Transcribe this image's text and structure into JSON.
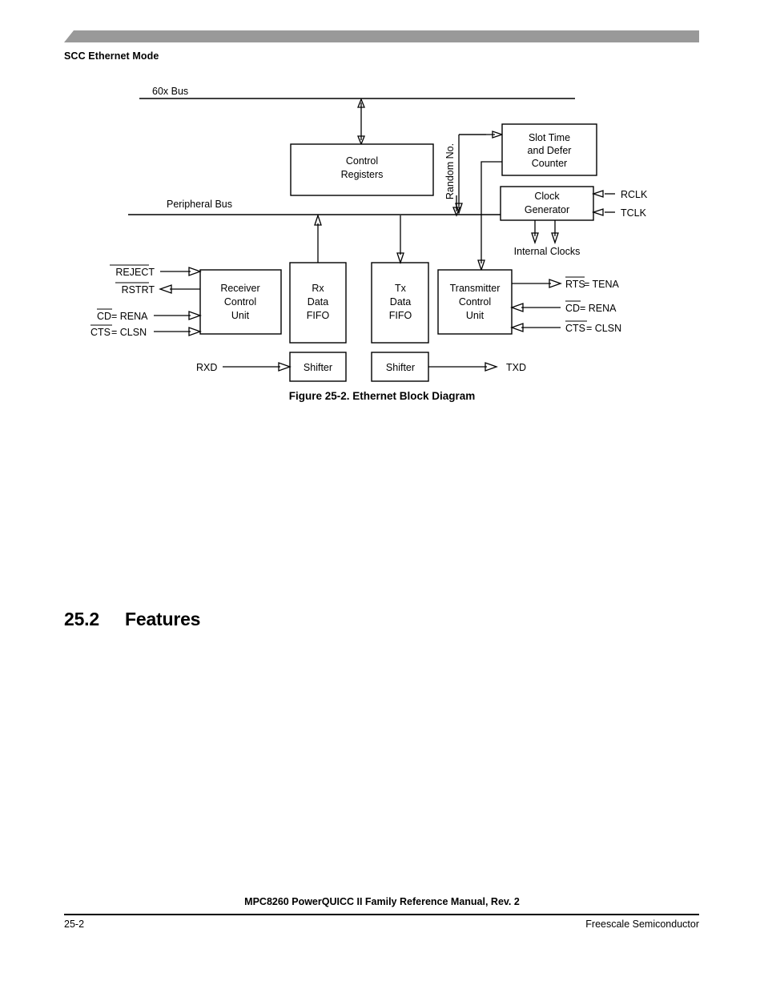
{
  "page": {
    "running_head": "SCC Ethernet Mode",
    "footer_title": "MPC8260 PowerQUICC II Family Reference Manual, Rev. 2",
    "footer_page": "25-2",
    "footer_company": "Freescale Semiconductor",
    "bar_color": "#999999"
  },
  "section": {
    "number": "25.2",
    "title": "Features"
  },
  "figure": {
    "caption": "Figure 25-2. Ethernet Block Diagram",
    "buses": {
      "top": "60x Bus",
      "peripheral": "Peripheral Bus"
    },
    "rotated_label": "Random No.",
    "blocks": {
      "control_registers": [
        "Control",
        "Registers"
      ],
      "slot_time": [
        "Slot Time",
        "and Defer",
        "Counter"
      ],
      "clock_generator": [
        "Clock",
        "Generator"
      ],
      "receiver_control": [
        "Receiver",
        "Control",
        "Unit"
      ],
      "rx_fifo": [
        "Rx",
        "Data",
        "FIFO"
      ],
      "tx_fifo": [
        "Tx",
        "Data",
        "FIFO"
      ],
      "transmitter_control": [
        "Transmitter",
        "Control",
        "Unit"
      ],
      "rx_shifter": "Shifter",
      "tx_shifter": "Shifter"
    },
    "labels": {
      "internal_clocks": "Internal Clocks",
      "rclk": "RCLK",
      "tclk": "TCLK",
      "rxd": "RXD",
      "txd": "TXD"
    },
    "signals_left": {
      "reject": {
        "over": "REJECT",
        "rest": ""
      },
      "rstrt": {
        "over": "RSTRT",
        "rest": ""
      },
      "cd_rena": {
        "over": "CD",
        "rest": " = RENA"
      },
      "cts_clsn": {
        "over": "CTS",
        "rest": " = CLSN"
      }
    },
    "signals_right": {
      "rts_tena": {
        "over": "RTS",
        "rest": " = TENA"
      },
      "cd_rena": {
        "over": "CD",
        "rest": " = RENA"
      },
      "cts_clsn": {
        "over": "CTS",
        "rest": " = CLSN"
      }
    }
  }
}
